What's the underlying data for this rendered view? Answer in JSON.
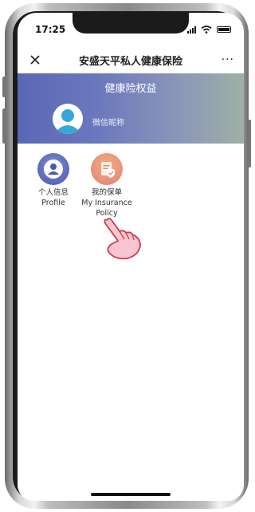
{
  "status_bar": {
    "time": "17:25"
  },
  "nav": {
    "title": "安盛天平私人健康保险",
    "more_glyph": "···"
  },
  "banner": {
    "title": "健康险权益",
    "nickname": "微信昵称"
  },
  "menu": [
    {
      "label_cn": "个人信息",
      "label_en": "Profile"
    },
    {
      "label_cn": "我的保单",
      "label_en": "My Insurance Policy"
    }
  ],
  "icons": {
    "close": "close-icon",
    "more": "more-icon",
    "profile": "person-icon",
    "policy": "document-shield-icon",
    "pointer": "hand-pointer-icon"
  },
  "colors": {
    "banner_start": "#5a67b5",
    "banner_end": "#9fb0a6",
    "profile_icon": "#4a58b0",
    "policy_icon": "#e07f7a",
    "hand_outline": "#d0384f",
    "hand_fill": "#f7c6cf"
  }
}
